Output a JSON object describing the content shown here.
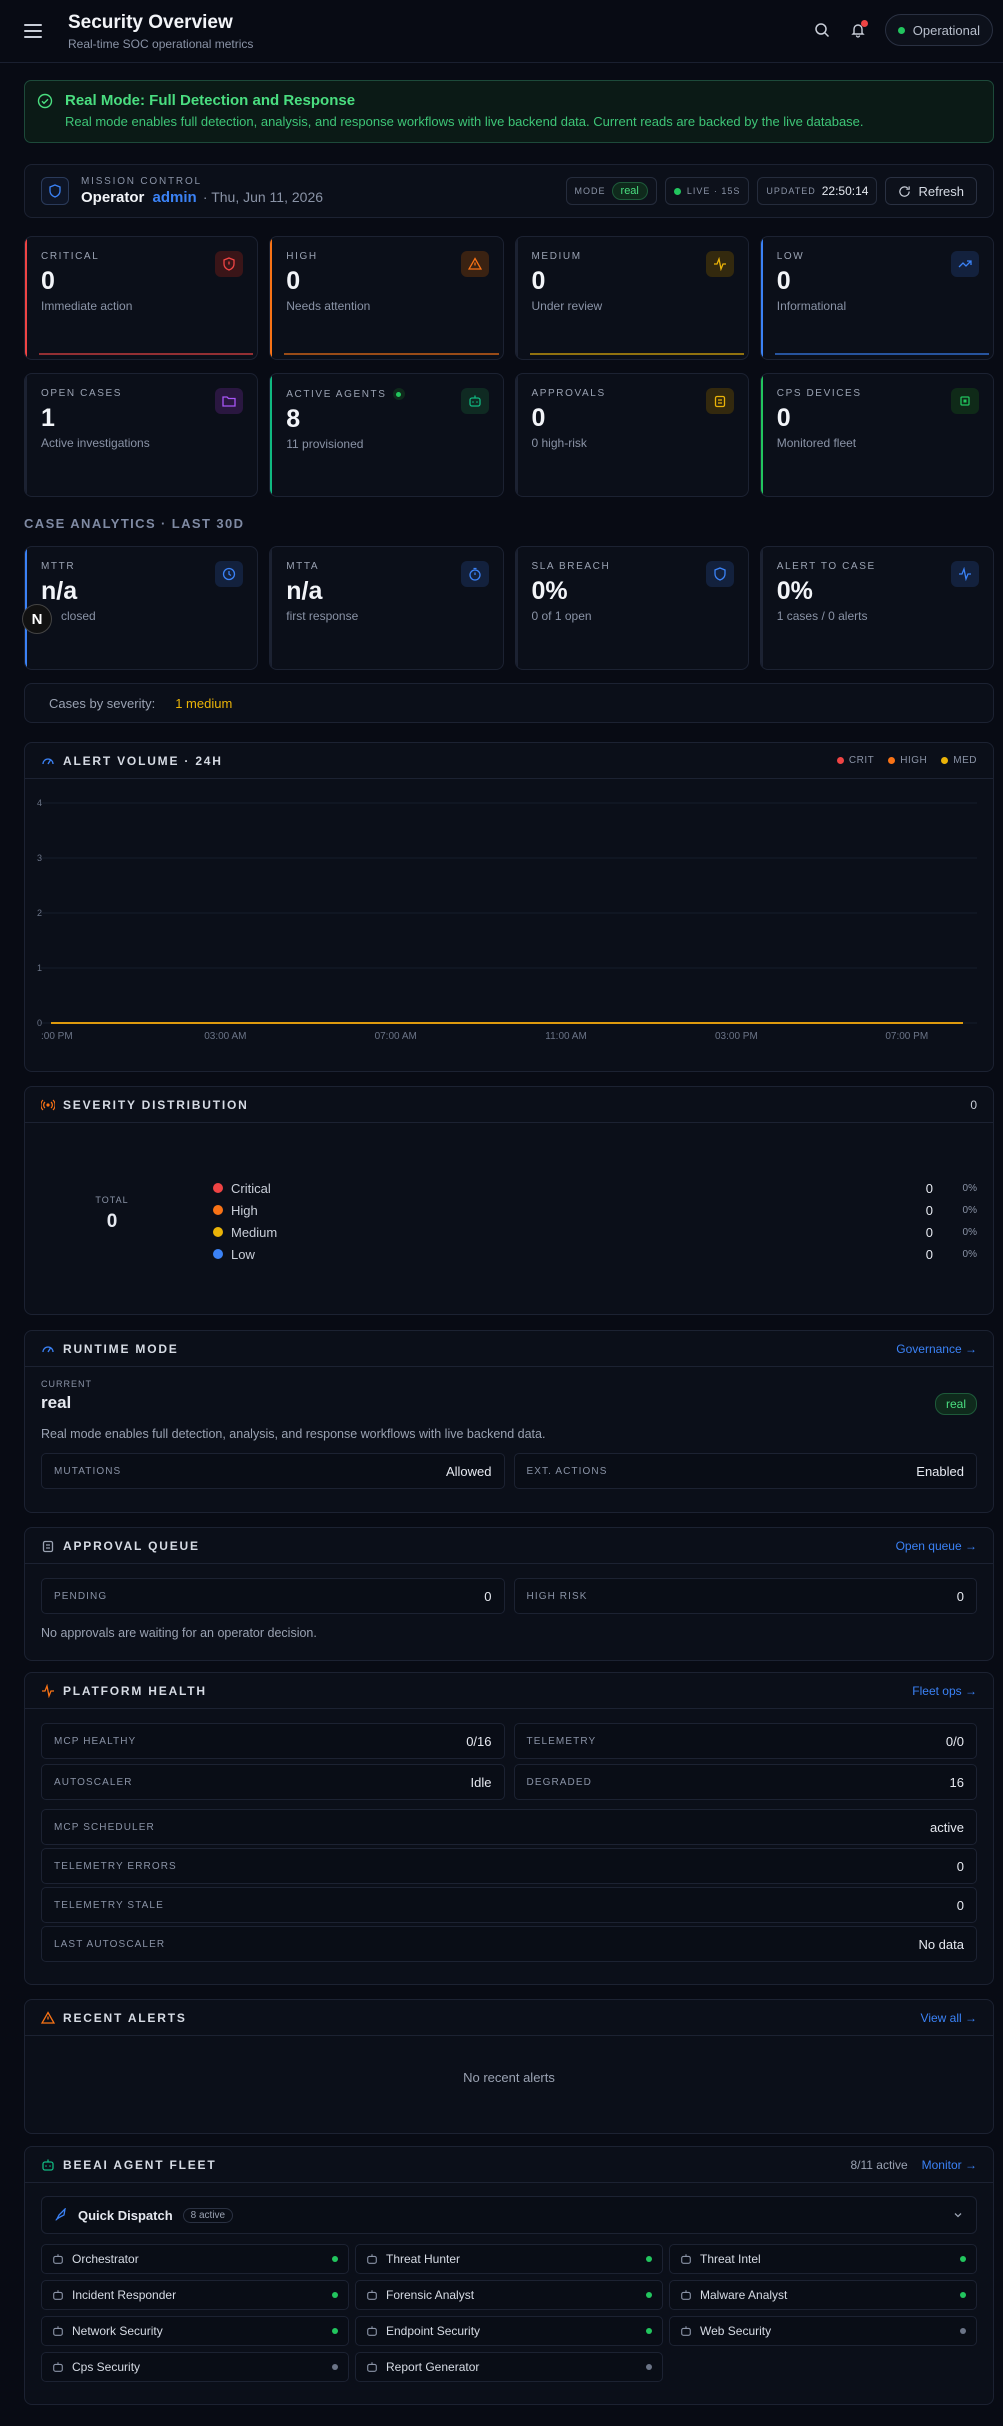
{
  "header": {
    "title": "Security Overview",
    "subtitle": "Real-time SOC operational metrics",
    "status": "Operational"
  },
  "banner": {
    "title": "Real Mode: Full Detection and Response",
    "text": "Real mode enables full detection, analysis, and response workflows with live backend data. Current reads are backed by the live database."
  },
  "mission": {
    "label": "MISSION CONTROL",
    "operator": "Operator",
    "user": "admin",
    "date": "· Thu, Jun 11, 2026",
    "mode_label": "MODE",
    "mode": "real",
    "live": "LIVE · 15S",
    "updated_label": "UPDATED",
    "updated": "22:50:14",
    "refresh": "Refresh"
  },
  "severity_cards": [
    {
      "label": "CRITICAL",
      "value": "0",
      "desc": "Immediate action",
      "color": "#ef4444"
    },
    {
      "label": "HIGH",
      "value": "0",
      "desc": "Needs attention",
      "color": "#f97316"
    },
    {
      "label": "MEDIUM",
      "value": "0",
      "desc": "Under review",
      "color": "#eab308"
    },
    {
      "label": "LOW",
      "value": "0",
      "desc": "Informational",
      "color": "#3b82f6"
    }
  ],
  "ops_cards": [
    {
      "label": "OPEN CASES",
      "value": "1",
      "desc": "Active investigations",
      "color": "#a855f7"
    },
    {
      "label": "ACTIVE AGENTS",
      "value": "8",
      "desc": "11 provisioned",
      "color": "#10b981"
    },
    {
      "label": "APPROVALS",
      "value": "0",
      "desc": "0 high-risk",
      "color": "#eab308"
    },
    {
      "label": "CPS DEVICES",
      "value": "0",
      "desc": "Monitored fleet",
      "color": "#22c55e"
    }
  ],
  "analytics_title": "CASE ANALYTICS · LAST 30D",
  "analytics_cards": [
    {
      "label": "MTTR",
      "value": "n/a",
      "desc": "closed",
      "color": "#3b82f6"
    },
    {
      "label": "MTTA",
      "value": "n/a",
      "desc": "first response",
      "color": "#3b82f6"
    },
    {
      "label": "SLA BREACH",
      "value": "0%",
      "desc": "0 of 1 open",
      "color": "#3b82f6"
    },
    {
      "label": "ALERT TO CASE",
      "value": "0%",
      "desc": "1 cases / 0 alerts",
      "color": "#3b82f6"
    }
  ],
  "cases_by_severity": {
    "label": "Cases by severity:",
    "value": "1 medium"
  },
  "chart_data": {
    "type": "line",
    "title": "ALERT VOLUME · 24H",
    "x": [
      ":00 PM",
      "03:00 AM",
      "07:00 AM",
      "11:00 AM",
      "03:00 PM",
      "07:00 PM"
    ],
    "ylim": [
      0,
      4
    ],
    "yticks": [
      "4",
      "3",
      "2",
      "1",
      "0"
    ],
    "series": [
      {
        "name": "CRIT",
        "color": "#ef4444",
        "values": [
          0,
          0,
          0,
          0,
          0,
          0
        ]
      },
      {
        "name": "HIGH",
        "color": "#f97316",
        "values": [
          0,
          0,
          0,
          0,
          0,
          0
        ]
      },
      {
        "name": "MED",
        "color": "#eab308",
        "values": [
          0,
          0,
          0,
          0,
          0,
          0
        ]
      }
    ]
  },
  "distribution": {
    "title": "SEVERITY DISTRIBUTION",
    "count": "0",
    "total_label": "TOTAL",
    "total": "0",
    "rows": [
      {
        "name": "Critical",
        "value": "0",
        "pct": "0%",
        "color": "#ef4444"
      },
      {
        "name": "High",
        "value": "0",
        "pct": "0%",
        "color": "#f97316"
      },
      {
        "name": "Medium",
        "value": "0",
        "pct": "0%",
        "color": "#eab308"
      },
      {
        "name": "Low",
        "value": "0",
        "pct": "0%",
        "color": "#3b82f6"
      }
    ]
  },
  "runtime": {
    "title": "RUNTIME MODE",
    "link": "Governance →",
    "current_label": "CURRENT",
    "current": "real",
    "badge": "real",
    "desc": "Real mode enables full detection, analysis, and response workflows with live backend data.",
    "mutations_label": "MUTATIONS",
    "mutations": "Allowed",
    "ext_label": "EXT. ACTIONS",
    "ext": "Enabled"
  },
  "approval": {
    "title": "APPROVAL QUEUE",
    "link": "Open queue →",
    "pending_label": "PENDING",
    "pending": "0",
    "risk_label": "HIGH RISK",
    "risk": "0",
    "empty": "No approvals are waiting for an operator decision."
  },
  "health": {
    "title": "PLATFORM HEALTH",
    "link": "Fleet ops →",
    "pairs": [
      {
        "k": "MCP HEALTHY",
        "v": "0/16"
      },
      {
        "k": "TELEMETRY",
        "v": "0/0"
      },
      {
        "k": "AUTOSCALER",
        "v": "Idle"
      },
      {
        "k": "DEGRADED",
        "v": "16"
      }
    ],
    "rows": [
      {
        "k": "MCP SCHEDULER",
        "v": "active"
      },
      {
        "k": "TELEMETRY ERRORS",
        "v": "0"
      },
      {
        "k": "TELEMETRY STALE",
        "v": "0"
      },
      {
        "k": "LAST AUTOSCALER",
        "v": "No data"
      }
    ]
  },
  "alerts": {
    "title": "RECENT ALERTS",
    "link": "View all →",
    "empty": "No recent alerts"
  },
  "fleet": {
    "title": "BEEAI AGENT FLEET",
    "count": "8/11 active",
    "link": "Monitor →",
    "dispatch": "Quick Dispatch",
    "dispatch_badge": "8 active",
    "agents": [
      {
        "name": "Orchestrator",
        "active": true
      },
      {
        "name": "Threat Hunter",
        "active": true
      },
      {
        "name": "Threat Intel",
        "active": true
      },
      {
        "name": "Incident Responder",
        "active": true
      },
      {
        "name": "Forensic Analyst",
        "active": true
      },
      {
        "name": "Malware Analyst",
        "active": true
      },
      {
        "name": "Network Security",
        "active": true
      },
      {
        "name": "Endpoint Security",
        "active": true
      },
      {
        "name": "Web Security",
        "active": false
      },
      {
        "name": "Cps Security",
        "active": false
      },
      {
        "name": "Report Generator",
        "active": false
      }
    ]
  },
  "colors": {
    "accent": "#3b82f6",
    "success": "#4ade80"
  }
}
